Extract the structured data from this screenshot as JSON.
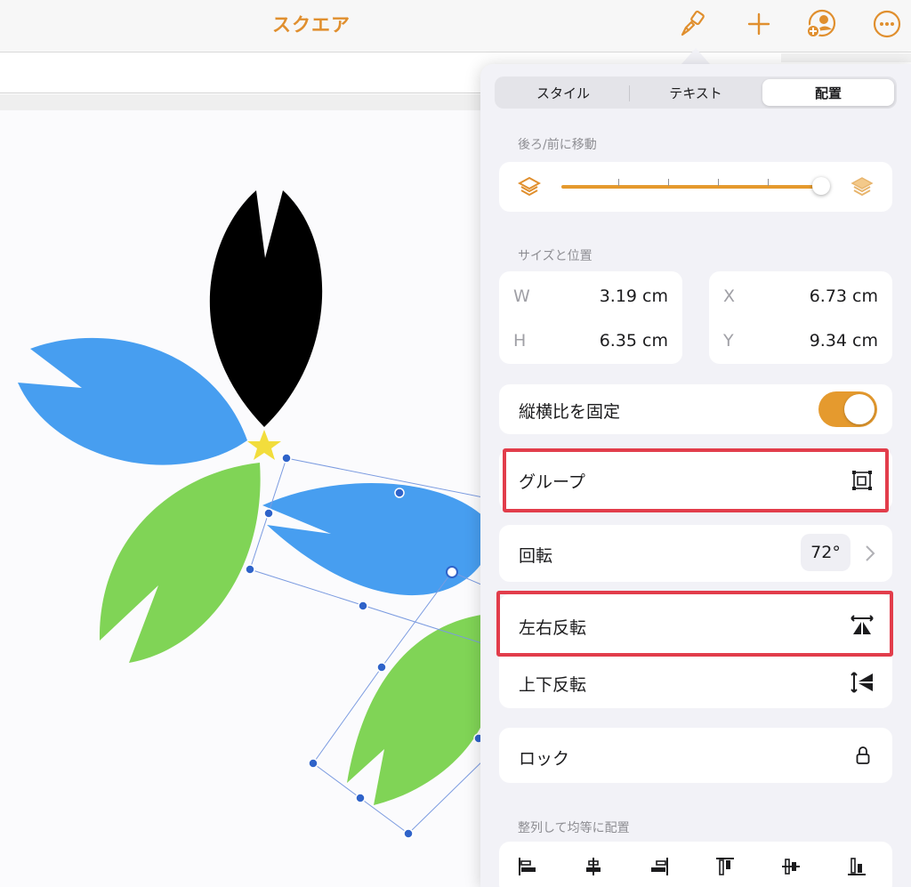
{
  "toolbar": {
    "document_title": "スクエア",
    "icons": [
      "paintbrush-icon",
      "plus-icon",
      "collaborate-icon",
      "more-icon"
    ],
    "accent_color": "#E08F2E"
  },
  "inspector": {
    "tabs": [
      {
        "label": "スタイル",
        "active": false
      },
      {
        "label": "テキスト",
        "active": false
      },
      {
        "label": "配置",
        "active": true
      }
    ],
    "move_section": {
      "label": "後ろ/前に移動",
      "slider_value": 1.0
    },
    "size_position": {
      "label": "サイズと位置",
      "w_label": "W",
      "w_value": "3.19 cm",
      "h_label": "H",
      "h_value": "6.35 cm",
      "x_label": "X",
      "x_value": "6.73 cm",
      "y_label": "Y",
      "y_value": "9.34 cm"
    },
    "constrain_proportions": {
      "label": "縦横比を固定",
      "on": true
    },
    "group": {
      "label": "グループ",
      "highlighted": true
    },
    "rotate": {
      "label": "回転",
      "value": "72°"
    },
    "flip_horizontal": {
      "label": "左右反転",
      "highlighted": true
    },
    "flip_vertical": {
      "label": "上下反転"
    },
    "lock": {
      "label": "ロック"
    },
    "align_section": {
      "label": "整列して均等に配置",
      "icons": [
        "align-left-icon",
        "align-center-icon",
        "align-right-icon",
        "align-top-icon",
        "align-middle-icon",
        "align-bottom-icon"
      ]
    },
    "highlight_color": "#E23D4B"
  },
  "canvas": {
    "shape_colors": {
      "black": "#000000",
      "blue": "#479EF0",
      "green": "#80D456",
      "star": "#F2DD3C"
    }
  }
}
